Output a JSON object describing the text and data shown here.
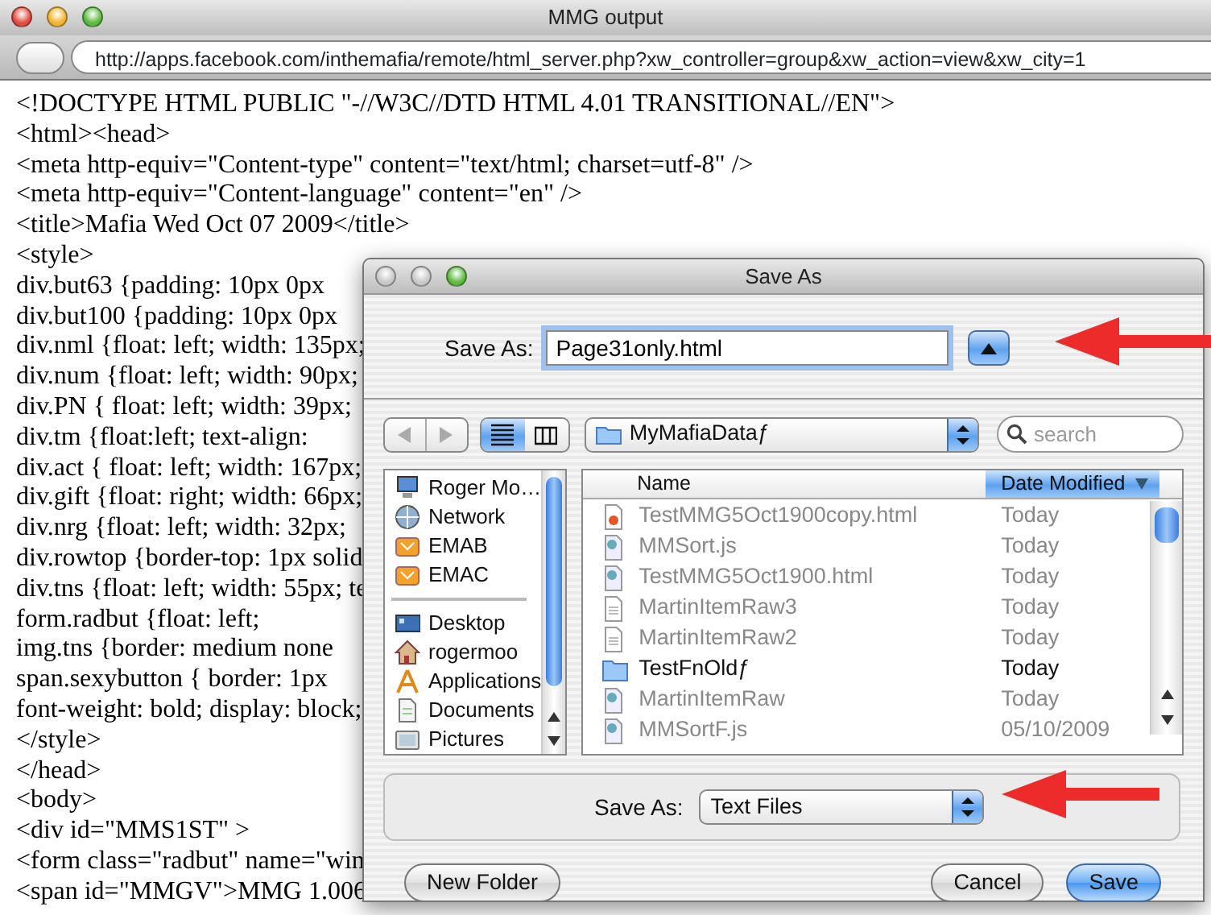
{
  "browser_window": {
    "title": "MMG output",
    "url": "http://apps.facebook.com/inthemafia/remote/html_server.php?xw_controller=group&xw_action=view&xw_city=1"
  },
  "source_lines": [
    "<!DOCTYPE HTML PUBLIC \"-//W3C//DTD HTML 4.01 TRANSITIONAL//EN\">",
    "<html><head>",
    "<meta http-equiv=\"Content-type\" content=\"text/html; charset=utf-8\" />",
    "<meta http-equiv=\"Content-language\" content=\"en\" />",
    "<title>Mafia Wed Oct 07 2009</title>",
    "<style>",
    "div.but63 {padding: 10px 0px",
    "div.but100 {padding: 10px 0px",
    "div.nml {float: left; width: 135px;",
    "div.num {float: left; width: 90px;",
    "div.PN { float: left; width: 39px;",
    "div.tm {float:left; text-align:",
    "div.act { float: left; width: 167px;",
    "div.gift {float: right; width: 66px;",
    "div.nrg {float: left; width: 32px;",
    "div.rowtop {border-top: 1px solid",
    "div.tns {float: left; width: 55px; te",
    "form.radbut {float: left;",
    "img.tns {border: medium none",
    "span.sexybutton { border: 1px",
    "font-weight: bold; display: block;",
    "</style>",
    "</head>",
    "<body>",
    "<div id=\"MMS1ST\" >",
    "<form class=\"radbut\" name=\"win",
    "<span id=\"MMGV\">MMG 1.006"
  ],
  "save_dialog": {
    "title": "Save As",
    "save_as_label": "Save As:",
    "file_name": "Page31only.html",
    "view_modes": [
      {
        "kind": "list",
        "selected": true
      },
      {
        "kind": "columns",
        "selected": false
      }
    ],
    "location": "MyMafiaDataƒ",
    "search": {
      "placeholder": "search"
    },
    "sidebar": {
      "groups": [
        [
          {
            "label": "Roger Mo…",
            "kind": "computer"
          },
          {
            "label": "Network",
            "kind": "network"
          },
          {
            "label": "EMAB",
            "kind": "drive"
          },
          {
            "label": "EMAC",
            "kind": "drive"
          }
        ],
        [
          {
            "label": "Desktop",
            "kind": "desktop"
          },
          {
            "label": "rogermoo",
            "kind": "home"
          },
          {
            "label": "Applications",
            "kind": "applications"
          },
          {
            "label": "Documents",
            "kind": "documents"
          },
          {
            "label": "Pictures",
            "kind": "pictures"
          }
        ]
      ]
    },
    "columns": [
      {
        "label": "Name",
        "selected": false
      },
      {
        "label": "Date Modified",
        "selected": true
      }
    ],
    "files": [
      {
        "name": "TestMMG5Oct1900copy.html",
        "date": "Today",
        "kind": "html",
        "enabled": false
      },
      {
        "name": "MMSort.js",
        "date": "Today",
        "kind": "script",
        "enabled": false
      },
      {
        "name": "TestMMG5Oct1900.html",
        "date": "Today",
        "kind": "script",
        "enabled": false
      },
      {
        "name": "MartinItemRaw3",
        "date": "Today",
        "kind": "text",
        "enabled": false
      },
      {
        "name": "MartinItemRaw2",
        "date": "Today",
        "kind": "text",
        "enabled": false
      },
      {
        "name": "TestFnOldƒ",
        "date": "Today",
        "kind": "folder",
        "enabled": true
      },
      {
        "name": "MartinItemRaw",
        "date": "Today",
        "kind": "script",
        "enabled": false
      },
      {
        "name": "MMSortF.js",
        "date": "05/10/2009",
        "kind": "script",
        "enabled": false
      }
    ],
    "format": {
      "label": "Save As:",
      "value": "Text Files"
    },
    "buttons": [
      {
        "label": "New Folder",
        "kind": "normal"
      },
      {
        "label": "Cancel",
        "kind": "normal"
      },
      {
        "label": "Save",
        "kind": "default"
      }
    ]
  }
}
